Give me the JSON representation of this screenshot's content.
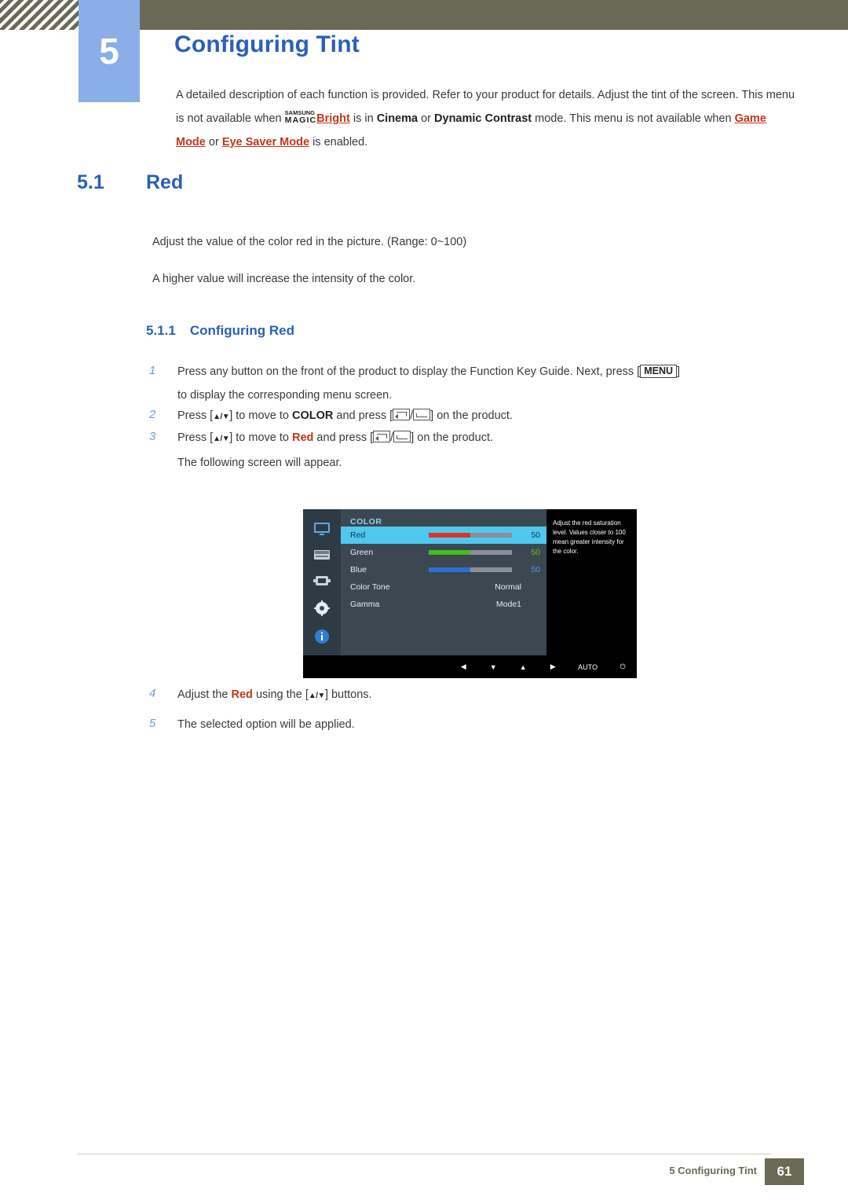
{
  "header": {
    "chapter_number": "5",
    "chapter_title": "Configuring Tint"
  },
  "intro": {
    "line1_a": "A detailed description of each function is provided. Refer to your product for details. Adjust the tint",
    "line2_a": "of the screen. This menu is not available when ",
    "magic_top": "SAMSUNG",
    "magic_bottom": "MAGIC",
    "bright": "Bright",
    "line2_b": " is in ",
    "cinema": "Cinema",
    "line2_c": " or ",
    "dynamic_contrast": "Dynamic Contrast",
    "line3_a": "mode. This menu is not available when ",
    "game_mode": "Game Mode",
    "line3_b": " or ",
    "eye_saver_mode": "Eye Saver Mode",
    "line3_c": " is enabled."
  },
  "section": {
    "number": "5.1",
    "title": "Red",
    "para1": "Adjust the value of the color red in the picture. (Range: 0~100)",
    "para2": "A higher value will increase the intensity of the color.",
    "subsection_number": "5.1.1",
    "subsection_title": "Configuring Red"
  },
  "steps": [
    {
      "num": "1",
      "text_a": "Press any button on the front of the product to display the Function Key Guide. Next, press [",
      "kbd": "MENU",
      "text_b": "]",
      "text_c": "to display the corresponding menu screen."
    },
    {
      "num": "2",
      "text_a": "Press [",
      "arrows": "▲/▼",
      "text_b": "] to move to ",
      "emph": "COLOR",
      "text_c": " and press [",
      "text_d": "/",
      "text_e": "] on the product."
    },
    {
      "num": "3",
      "text_a": "Press [",
      "arrows": "▲/▼",
      "text_b": "] to move to ",
      "emph": "Red",
      "text_c": " and press [",
      "text_d": "/",
      "text_e": "] on the product.",
      "note": "The following screen will appear."
    },
    {
      "num": "4",
      "text_a": "Adjust the ",
      "emph": "Red",
      "text_b": " using the [",
      "arrows": "▲/▼",
      "text_c": "] buttons."
    },
    {
      "num": "5",
      "text_a": "The selected option will be applied."
    }
  ],
  "osd": {
    "menu_title": "COLOR",
    "rows": [
      {
        "label": "Red",
        "value": "50",
        "type": "slider",
        "selected": true,
        "fill_color": "#d9342b",
        "fill_pct": 50
      },
      {
        "label": "Green",
        "value": "50",
        "type": "slider",
        "selected": false,
        "fill_color": "#3fbf1f",
        "fill_pct": 50
      },
      {
        "label": "Blue",
        "value": "50",
        "type": "slider",
        "selected": false,
        "fill_color": "#2f6fd0",
        "fill_pct": 50
      },
      {
        "label": "Color Tone",
        "value": "Normal",
        "type": "text",
        "selected": false
      },
      {
        "label": "Gamma",
        "value": "Mode1",
        "type": "text",
        "selected": false
      }
    ],
    "help_text": "Adjust the red saturation level. Values closer to 100 mean greater intensity for the color.",
    "buttons": [
      "◀",
      "▼",
      "▲",
      "▶",
      "AUTO",
      "⏻"
    ],
    "sidebar_icons": [
      "monitor-icon",
      "brightness-icon",
      "screen-adjust-icon",
      "settings-gear-icon",
      "information-icon"
    ]
  },
  "footer": {
    "text": "5 Configuring Tint",
    "page": "61"
  },
  "colors": {
    "accent_blue": "#2b5fb9",
    "badge_blue": "#89aee8",
    "olive": "#6b6a56",
    "red": "#c3361a"
  }
}
